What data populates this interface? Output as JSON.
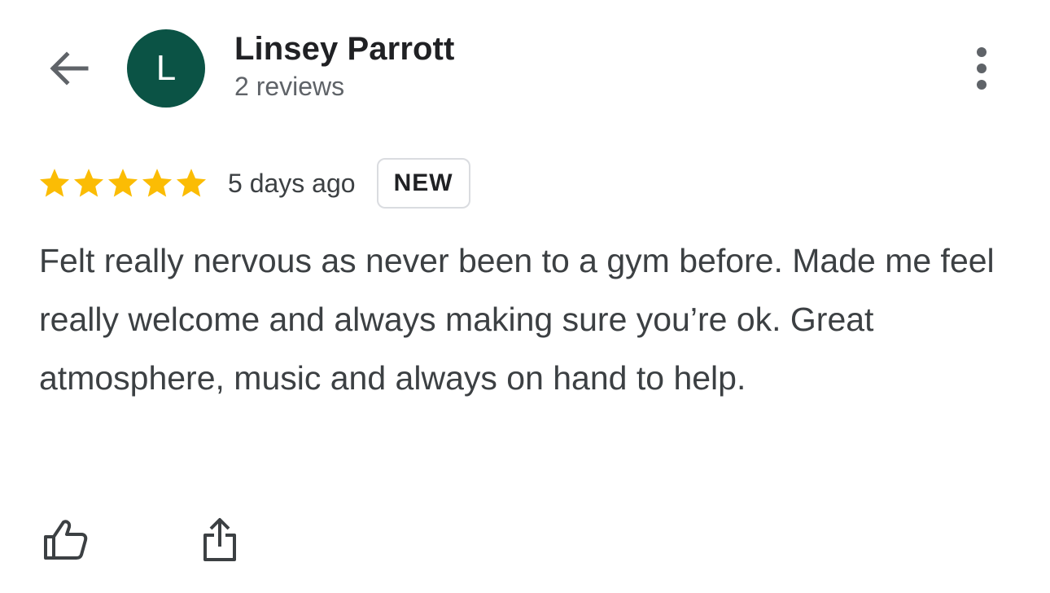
{
  "header": {
    "back_icon": "arrow-left-icon",
    "more_icon": "more-vert-icon",
    "icon_color": "#5f6368"
  },
  "reviewer": {
    "avatar_letter": "L",
    "avatar_color": "#0b5345",
    "name": "Linsey Parrott",
    "review_count": "2 reviews"
  },
  "review": {
    "rating": 5,
    "max_rating": 5,
    "star_color": "#fbbc04",
    "date": "5 days ago",
    "badge": "NEW",
    "text": "Felt really nervous as never been to a gym before. Made me feel really welcome and always making sure you’re ok. Great atmosphere, music and always on hand to help."
  },
  "actions": {
    "like_icon": "thumb-up-icon",
    "share_icon": "share-icon"
  }
}
